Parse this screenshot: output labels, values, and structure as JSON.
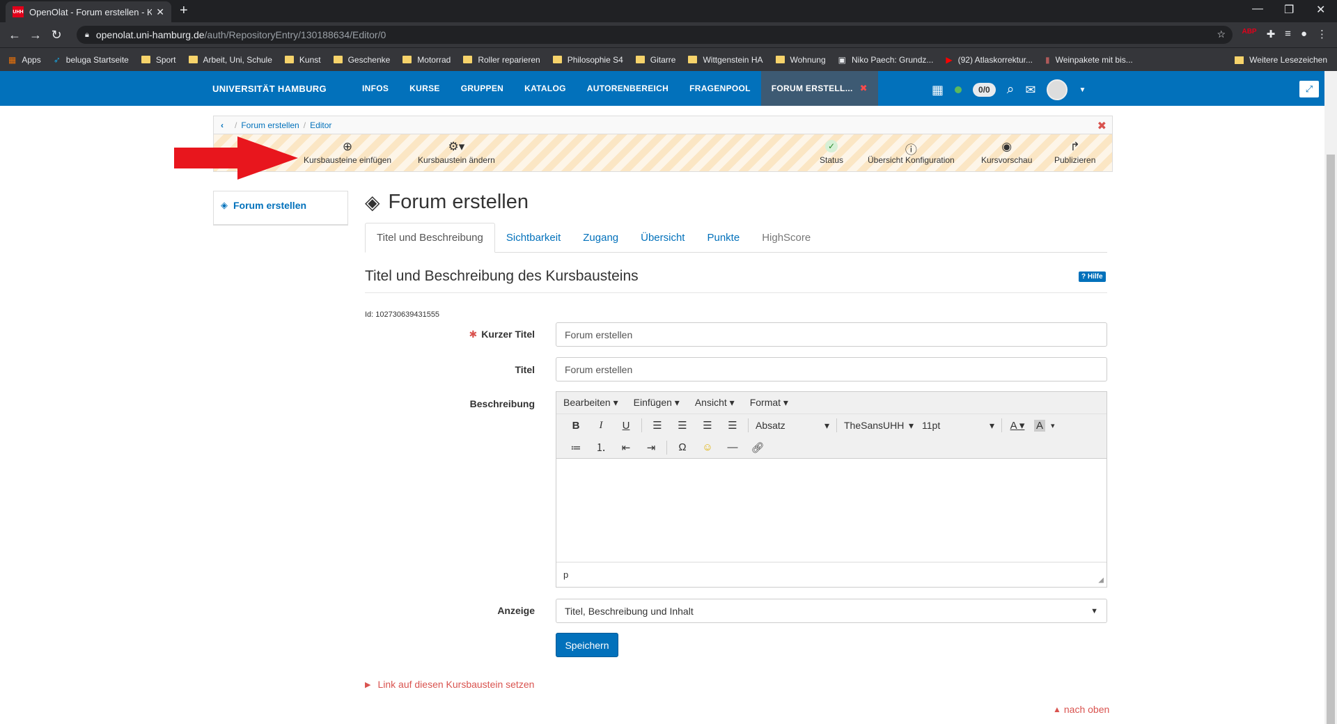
{
  "browser": {
    "tab_title": "OpenOlat - Forum erstellen - Kur",
    "tab_favicon": "UHH",
    "url_host": "openolat.uni-hamburg.de",
    "url_path": "/auth/RepositoryEntry/130188634/Editor/0",
    "bookmarks": [
      "Apps",
      "beluga Startseite",
      "Sport",
      "Arbeit, Uni, Schule",
      "Kunst",
      "Geschenke",
      "Motorrad",
      "Roller reparieren",
      "Philosophie S4",
      "Gitarre",
      "Wittgenstein HA",
      "Wohnung",
      "Niko Paech: Grundz...",
      "(92) Atlaskorrektur...",
      "Weinpakete mit bis..."
    ],
    "bookmarks_more": "Weitere Lesezeichen"
  },
  "header": {
    "logo": "UNIVERSITÄT HAMBURG",
    "nav": [
      "INFOS",
      "KURSE",
      "GRUPPEN",
      "KATALOG",
      "AUTORENBEREICH",
      "FRAGENPOOL"
    ],
    "active_tab": "FORUM ERSTELL...",
    "counter": "0/0"
  },
  "breadcrumb": {
    "items": [
      "Forum erstellen",
      "Editor"
    ]
  },
  "toolbar": {
    "insert": "Kursbausteine einfügen",
    "change": "Kursbaustein ändern",
    "status": "Status",
    "overview": "Übersicht Konfiguration",
    "preview": "Kursvorschau",
    "publish": "Publizieren"
  },
  "tree": {
    "item": "Forum erstellen"
  },
  "main": {
    "title": "Forum erstellen",
    "tabs": [
      "Titel und Beschreibung",
      "Sichtbarkeit",
      "Zugang",
      "Übersicht",
      "Punkte",
      "HighScore"
    ],
    "section_title": "Titel und Beschreibung des Kursbausteins",
    "help": "Hilfe",
    "id_text": "Id: 102730639431555"
  },
  "form": {
    "short_title_label": "Kurzer Titel",
    "short_title_value": "Forum erstellen",
    "title_label": "Titel",
    "title_value": "Forum erstellen",
    "description_label": "Beschreibung",
    "display_label": "Anzeige",
    "display_value": "Titel, Beschreibung und Inhalt",
    "save": "Speichern"
  },
  "editor": {
    "menu": [
      "Bearbeiten",
      "Einfügen",
      "Ansicht",
      "Format"
    ],
    "block_format": "Absatz",
    "font": "TheSansUHH",
    "size": "11pt",
    "status_path": "p"
  },
  "footer": {
    "link_toggle": "Link auf diesen Kursbaustein setzen",
    "to_top": "nach oben"
  },
  "colors": {
    "brand": "#0271bb",
    "danger": "#d9534f",
    "arrow": "#e8161d"
  }
}
